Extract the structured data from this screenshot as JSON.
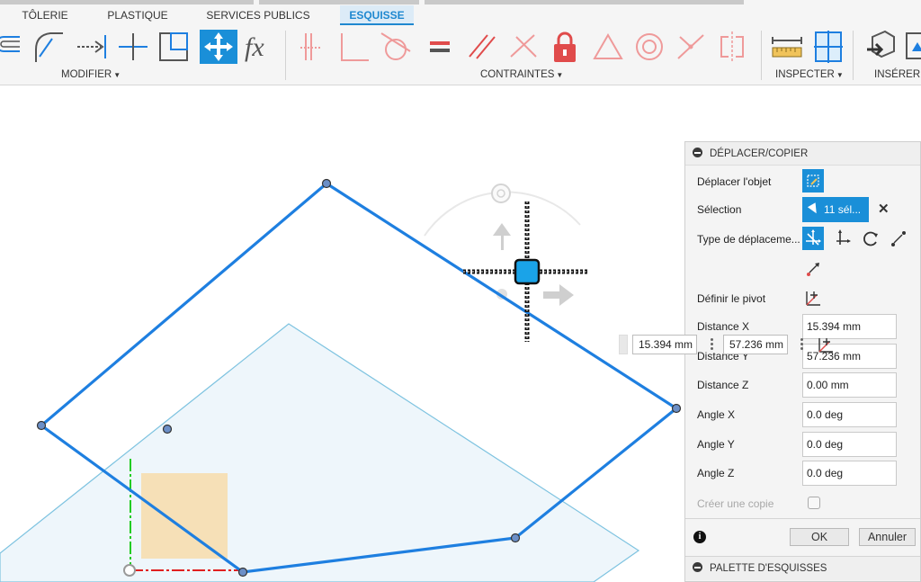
{
  "tabs": [
    {
      "label": "TÔLERIE"
    },
    {
      "label": "PLASTIQUE"
    },
    {
      "label": "SERVICES PUBLICS"
    },
    {
      "label": "ESQUISSE"
    }
  ],
  "groups": {
    "modifier": "MODIFIER",
    "contraintes": "CONTRAINTES",
    "inspecter": "INSPECTER",
    "inserer": "INSÉRER"
  },
  "tools": {
    "fx_label": "fx"
  },
  "dialog": {
    "title": "DÉPLACER/COPIER",
    "move_object_label": "Déplacer l'objet",
    "selection_label": "Sélection",
    "selection_value": "11 sél...",
    "move_type_label": "Type de déplaceme...",
    "pivot_label": "Définir le pivot",
    "distance_x_label": "Distance X",
    "distance_x_value": "15.394 mm",
    "distance_y_label": "Distance Y",
    "distance_y_value": "57.236 mm",
    "distance_z_label": "Distance Z",
    "distance_z_value": "0.00 mm",
    "angle_x_label": "Angle X",
    "angle_x_value": "0.0 deg",
    "angle_y_label": "Angle Y",
    "angle_y_value": "0.0 deg",
    "angle_z_label": "Angle Z",
    "angle_z_value": "0.0 deg",
    "copy_label": "Créer une copie",
    "ok_label": "OK",
    "cancel_label": "Annuler",
    "palette_title": "PALETTE D'ESQUISSES"
  },
  "inline": {
    "x_value": "15.394 mm",
    "y_value": "57.236 mm"
  },
  "colors": {
    "accent": "#1a8fd8",
    "sketch_line": "#1e7fe0",
    "plane_fill": "#eef6fb",
    "plane_edge": "#7ec3e0",
    "face_fill": "#f5deb3",
    "constraint_red": "#e04b4b",
    "axis_red": "#e02020",
    "axis_green": "#22cc22"
  }
}
